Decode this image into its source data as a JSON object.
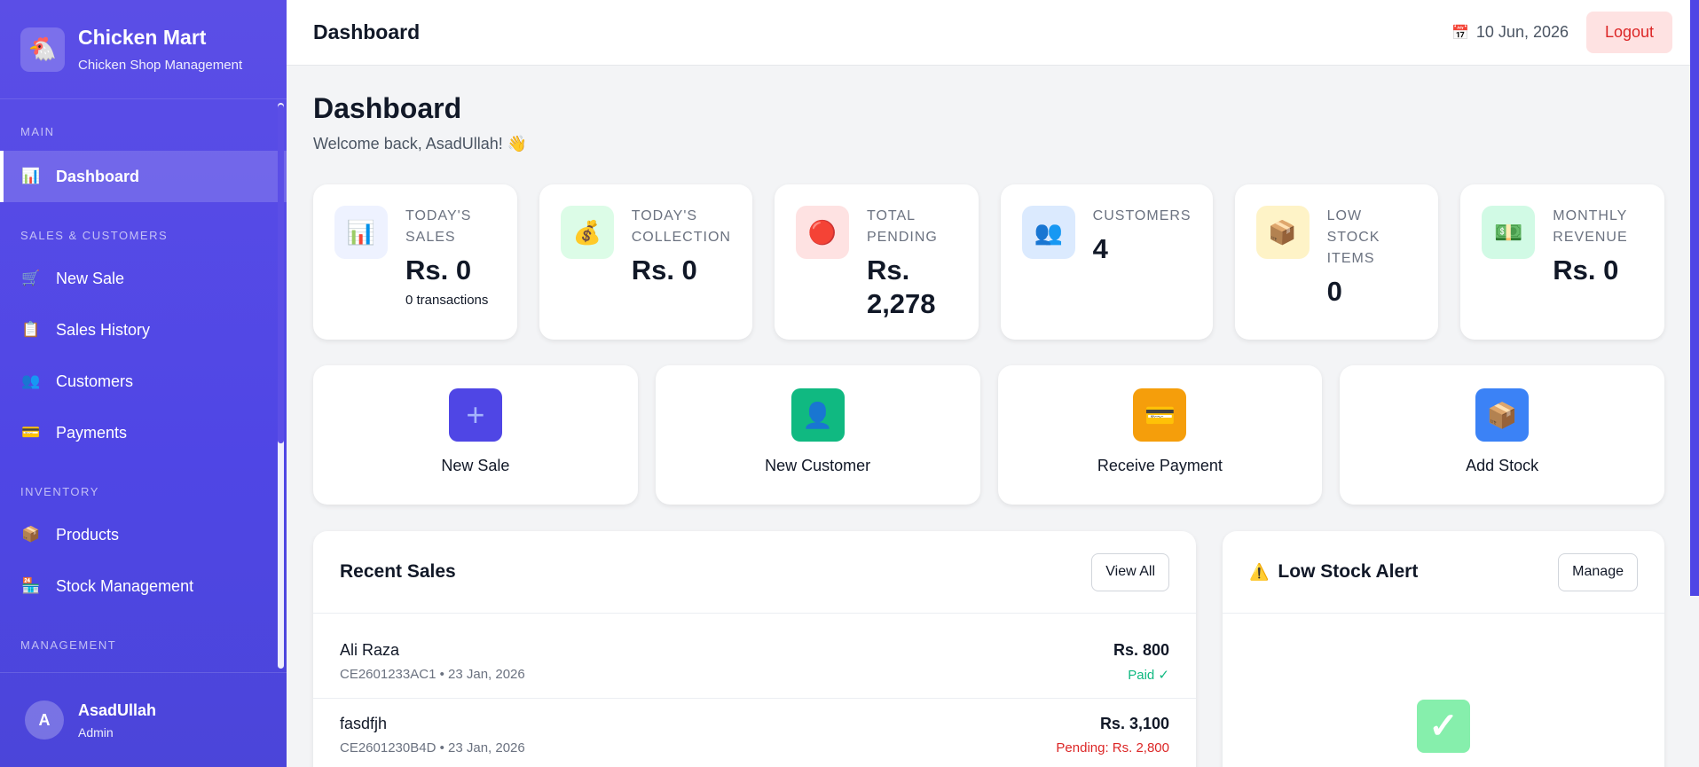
{
  "brand": {
    "logo": "🐔",
    "name": "Chicken Mart",
    "subtitle": "Chicken Shop Management"
  },
  "sidebar": {
    "sections": [
      {
        "label": "MAIN"
      },
      {
        "label": "SALES & CUSTOMERS"
      },
      {
        "label": "INVENTORY"
      },
      {
        "label": "MANAGEMENT"
      }
    ],
    "items": [
      {
        "label": "Dashboard",
        "icon": "📊",
        "icon_name": "bar-chart-icon"
      },
      {
        "label": "New Sale",
        "icon": "🛒",
        "icon_name": "cash-register-icon"
      },
      {
        "label": "Sales History",
        "icon": "📋",
        "icon_name": "clipboard-icon"
      },
      {
        "label": "Customers",
        "icon": "👥",
        "icon_name": "people-icon"
      },
      {
        "label": "Payments",
        "icon": "💳",
        "icon_name": "credit-card-icon"
      },
      {
        "label": "Products",
        "icon": "📦",
        "icon_name": "package-icon"
      },
      {
        "label": "Stock Management",
        "icon": "🏪",
        "icon_name": "store-icon"
      }
    ],
    "user": {
      "initial": "A",
      "name": "AsadUllah",
      "role": "Admin"
    }
  },
  "topbar": {
    "title": "Dashboard",
    "date_icon": "📅",
    "date": "10 Jun, 2026",
    "logout_label": "Logout"
  },
  "page": {
    "title": "Dashboard",
    "welcome": "Welcome back, AsadUllah! 👋"
  },
  "stats": [
    {
      "label_1": "TODAY'S",
      "label_2": "SALES",
      "value": "Rs. 0",
      "sub": "0 transactions",
      "icon": "📊",
      "icon_bg": "#eef2ff"
    },
    {
      "label_1": "TODAY'S",
      "label_2": "COLLECTION",
      "value": "Rs. 0",
      "sub": "",
      "icon": "💰",
      "icon_bg": "#dcfce7"
    },
    {
      "label_1": "TOTAL",
      "label_2": "PENDING",
      "value_1": "Rs.",
      "value_2": "2,278",
      "icon": "🔴",
      "icon_bg": "#fee2e2"
    },
    {
      "label_1": "CUSTOMERS",
      "label_2": "",
      "value": "4",
      "icon": "👥",
      "icon_bg": "#dbeafe"
    },
    {
      "label_1": "LOW STOCK",
      "label_2": "ITEMS",
      "value": "0",
      "icon": "📦",
      "icon_bg": "#fef3c7"
    },
    {
      "label_1": "MONTHLY",
      "label_2": "REVENUE",
      "value": "Rs. 0",
      "icon": "💵",
      "icon_bg": "#d1fae5"
    }
  ],
  "actions": [
    {
      "label": "New Sale",
      "icon": "+",
      "color": "#4f46e5"
    },
    {
      "label": "New Customer",
      "icon": "👤",
      "color": "#10b981"
    },
    {
      "label": "Receive Payment",
      "icon": "💳",
      "color": "#f59e0b"
    },
    {
      "label": "Add Stock",
      "icon": "📦",
      "color": "#3b82f6"
    }
  ],
  "recent_sales": {
    "title": "Recent Sales",
    "button": "View All",
    "rows": [
      {
        "name": "Ali Raza",
        "meta": "CE2601233AC1 • 23 Jan, 2026",
        "amount": "Rs. 800",
        "status": "Paid ✓",
        "status_color": "#10b981"
      },
      {
        "name": "fasdfjh",
        "meta": "CE2601230B4D • 23 Jan, 2026",
        "amount": "Rs. 3,100",
        "status": "Pending: Rs. 2,800",
        "status_color": "#dc2626"
      }
    ]
  },
  "low_stock": {
    "warn_icon": "⚠️",
    "title": "Low Stock Alert",
    "button": "Manage",
    "ok_icon": "✓"
  }
}
